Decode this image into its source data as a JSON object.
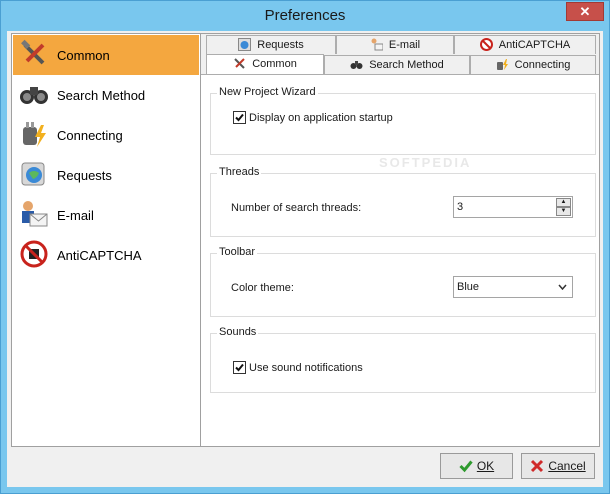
{
  "window": {
    "title": "Preferences",
    "close_glyph": "✕"
  },
  "colors": {
    "accent_selection": "#f4a73f",
    "titlebar": "#79c7ee",
    "close_button": "#c7504a"
  },
  "sidebar": {
    "items": [
      {
        "label": "Common",
        "icon": "tools-icon",
        "selected": true
      },
      {
        "label": "Search Method",
        "icon": "binoculars-icon",
        "selected": false
      },
      {
        "label": "Connecting",
        "icon": "plug-icon",
        "selected": false
      },
      {
        "label": "Requests",
        "icon": "globe-request-icon",
        "selected": false
      },
      {
        "label": "E-mail",
        "icon": "email-user-icon",
        "selected": false
      },
      {
        "label": "AntiCAPTCHA",
        "icon": "no-robot-icon",
        "selected": false
      }
    ]
  },
  "tabs": {
    "row1": [
      {
        "label": "Requests",
        "icon": "globe-request-icon"
      },
      {
        "label": "E-mail",
        "icon": "email-user-icon"
      },
      {
        "label": "AntiCAPTCHA",
        "icon": "no-robot-icon"
      }
    ],
    "row2": [
      {
        "label": "Common",
        "icon": "tools-icon",
        "active": true
      },
      {
        "label": "Search Method",
        "icon": "binoculars-icon",
        "active": false
      },
      {
        "label": "Connecting",
        "icon": "plug-icon",
        "active": false
      }
    ]
  },
  "groups": {
    "wizard": {
      "title": "New Project Wizard",
      "checkbox_label": "Display on application startup",
      "checked": true
    },
    "threads": {
      "title": "Threads",
      "label": "Number of search threads:",
      "value": "3"
    },
    "toolbar": {
      "title": "Toolbar",
      "label": "Color theme:",
      "value": "Blue"
    },
    "sounds": {
      "title": "Sounds",
      "checkbox_label": "Use sound notifications",
      "checked": true
    }
  },
  "buttons": {
    "ok": "OK",
    "cancel": "Cancel"
  },
  "watermark": "SOFTPEDIA"
}
